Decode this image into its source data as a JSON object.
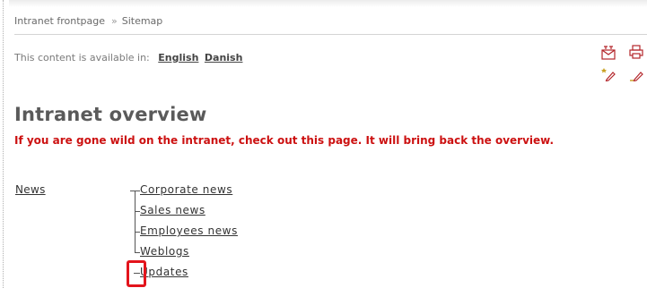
{
  "breadcrumb": {
    "items": [
      "Intranet frontpage",
      "Sitemap"
    ],
    "separator": "»"
  },
  "language": {
    "prompt": "This content is available in:",
    "options": [
      "English",
      "Danish"
    ],
    "active": "English"
  },
  "toolbar": {
    "icons": [
      "send-page-icon",
      "print-icon",
      "new-page-icon",
      "edit-page-icon"
    ]
  },
  "page": {
    "title": "Intranet overview",
    "intro": "If you are gone wild on the intranet, check out this page. It will bring back the overview."
  },
  "sitemap": {
    "section": "News",
    "children": [
      "Corporate news",
      "Sales news",
      "Employees news",
      "Weblogs",
      "Updates"
    ]
  },
  "colors": {
    "intro_text": "#cc1111",
    "highlight": "#e3141c",
    "title": "#5a5a5a"
  }
}
